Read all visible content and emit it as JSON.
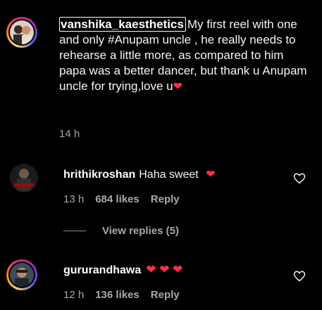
{
  "caption": {
    "username": "vanshika_kaesthetics",
    "text": "My first reel with one and only #Anupam uncle , he really needs to rehearse a little more, as compared to him papa was a better dancer, but thank u Anupam uncle for trying,love u",
    "emoji": "❤",
    "time": "14 h"
  },
  "comments": [
    {
      "username": "hrithikroshan",
      "text": "Haha sweet",
      "emoji": "❤",
      "time": "13 h",
      "likes": "684 likes",
      "reply_label": "Reply",
      "view_replies": "View replies (5)"
    },
    {
      "username": "gururandhawa",
      "text": "",
      "emoji": "❤ ❤ ❤",
      "time": "12 h",
      "likes": "136 likes",
      "reply_label": "Reply"
    }
  ],
  "colors": {
    "background": "#000000",
    "text": "#f5f5f5",
    "muted": "#a8a8a8",
    "heart": "#ff3040"
  }
}
